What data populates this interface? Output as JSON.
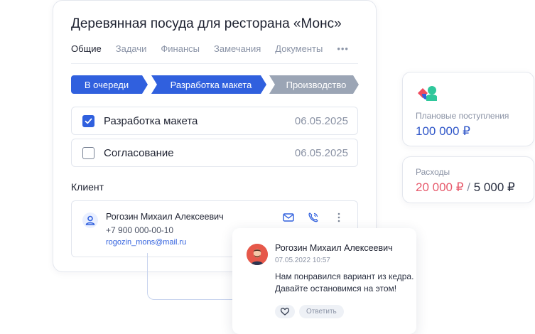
{
  "project": {
    "title": "Деревянная посуда для ресторана «Монс»",
    "tabs": [
      {
        "label": "Общие",
        "active": true
      },
      {
        "label": "Задачи",
        "active": false
      },
      {
        "label": "Финансы",
        "active": false
      },
      {
        "label": "Замечания",
        "active": false
      },
      {
        "label": "Документы",
        "active": false
      }
    ],
    "more_tabs": "•••"
  },
  "stages": [
    {
      "label": "В очереди",
      "color": "#3060de"
    },
    {
      "label": "Разработка макета",
      "color": "#3060de"
    },
    {
      "label": "Производство",
      "color": "#9ba5b5"
    }
  ],
  "tasks": [
    {
      "label": "Разработка макета",
      "date": "06.05.2025",
      "checked": true
    },
    {
      "label": "Согласование",
      "date": "06.05.2025",
      "checked": false
    }
  ],
  "client": {
    "heading": "Клиент",
    "name": "Рогозин Михаил Алексеевич",
    "phone": "+7 900 000-00-10",
    "email": "rogozin_mons@mail.ru",
    "icons": [
      "user-icon",
      "mail-icon",
      "phone-icon",
      "more-vertical-icon"
    ]
  },
  "comment": {
    "author": "Рогозин Михаил Алексеевич",
    "date": "07.05.2022 10:57",
    "lines": [
      "Нам понравился вариант из кедра.",
      "Давайте остановимся на этом!"
    ],
    "reply_label": "Ответить",
    "like_icon": "heart-icon"
  },
  "kpi": {
    "planned": {
      "label": "Плановые поступления",
      "value": "100 000 ₽"
    },
    "expenses": {
      "label": "Расходы",
      "spent": "20 000 ₽",
      "separator": "/",
      "budget": "5 000 ₽"
    }
  },
  "colors": {
    "accent": "#3060de",
    "inactive_stage": "#9ba5b5",
    "expense_red": "#e75a6c"
  }
}
